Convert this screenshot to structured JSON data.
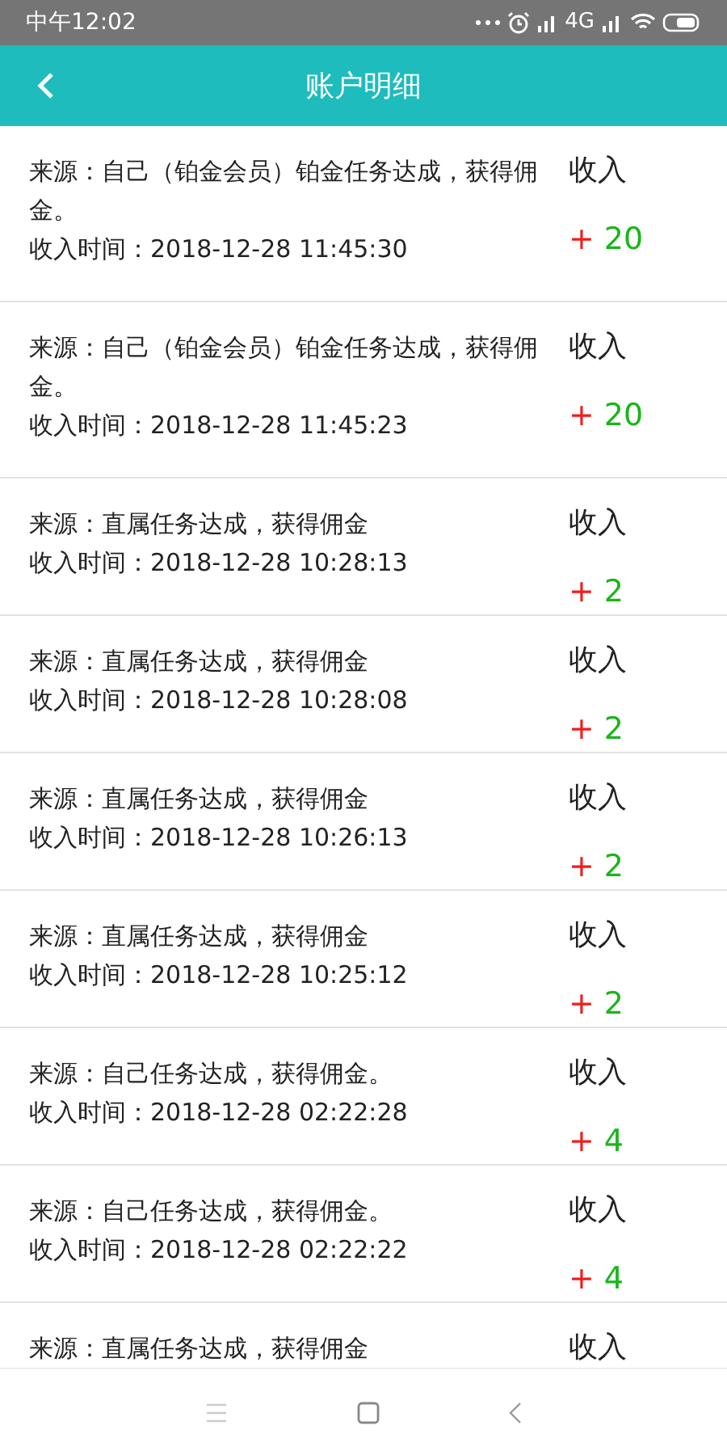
{
  "status_bar": {
    "time": "中午12:02",
    "network": "4G"
  },
  "header": {
    "title": "账户明细"
  },
  "records": [
    {
      "source": "来源：自己（铂金会员）铂金任务达成，获得佣金。",
      "time": "收入时间：2018-12-28 11:45:30",
      "type": "收入",
      "sign": "+",
      "amount": "20"
    },
    {
      "source": "来源：自己（铂金会员）铂金任务达成，获得佣金。",
      "time": "收入时间：2018-12-28 11:45:23",
      "type": "收入",
      "sign": "+",
      "amount": "20"
    },
    {
      "source": "来源：直属任务达成，获得佣金",
      "time": "收入时间：2018-12-28 10:28:13",
      "type": "收入",
      "sign": "+",
      "amount": "2"
    },
    {
      "source": "来源：直属任务达成，获得佣金",
      "time": "收入时间：2018-12-28 10:28:08",
      "type": "收入",
      "sign": "+",
      "amount": "2"
    },
    {
      "source": "来源：直属任务达成，获得佣金",
      "time": "收入时间：2018-12-28 10:26:13",
      "type": "收入",
      "sign": "+",
      "amount": "2"
    },
    {
      "source": "来源：直属任务达成，获得佣金",
      "time": "收入时间：2018-12-28 10:25:12",
      "type": "收入",
      "sign": "+",
      "amount": "2"
    },
    {
      "source": "来源：自己任务达成，获得佣金。",
      "time": "收入时间：2018-12-28 02:22:28",
      "type": "收入",
      "sign": "+",
      "amount": "4"
    },
    {
      "source": "来源：自己任务达成，获得佣金。",
      "time": "收入时间：2018-12-28 02:22:22",
      "type": "收入",
      "sign": "+",
      "amount": "4"
    },
    {
      "source": "来源：直属任务达成，获得佣金",
      "type": "收入"
    }
  ]
}
